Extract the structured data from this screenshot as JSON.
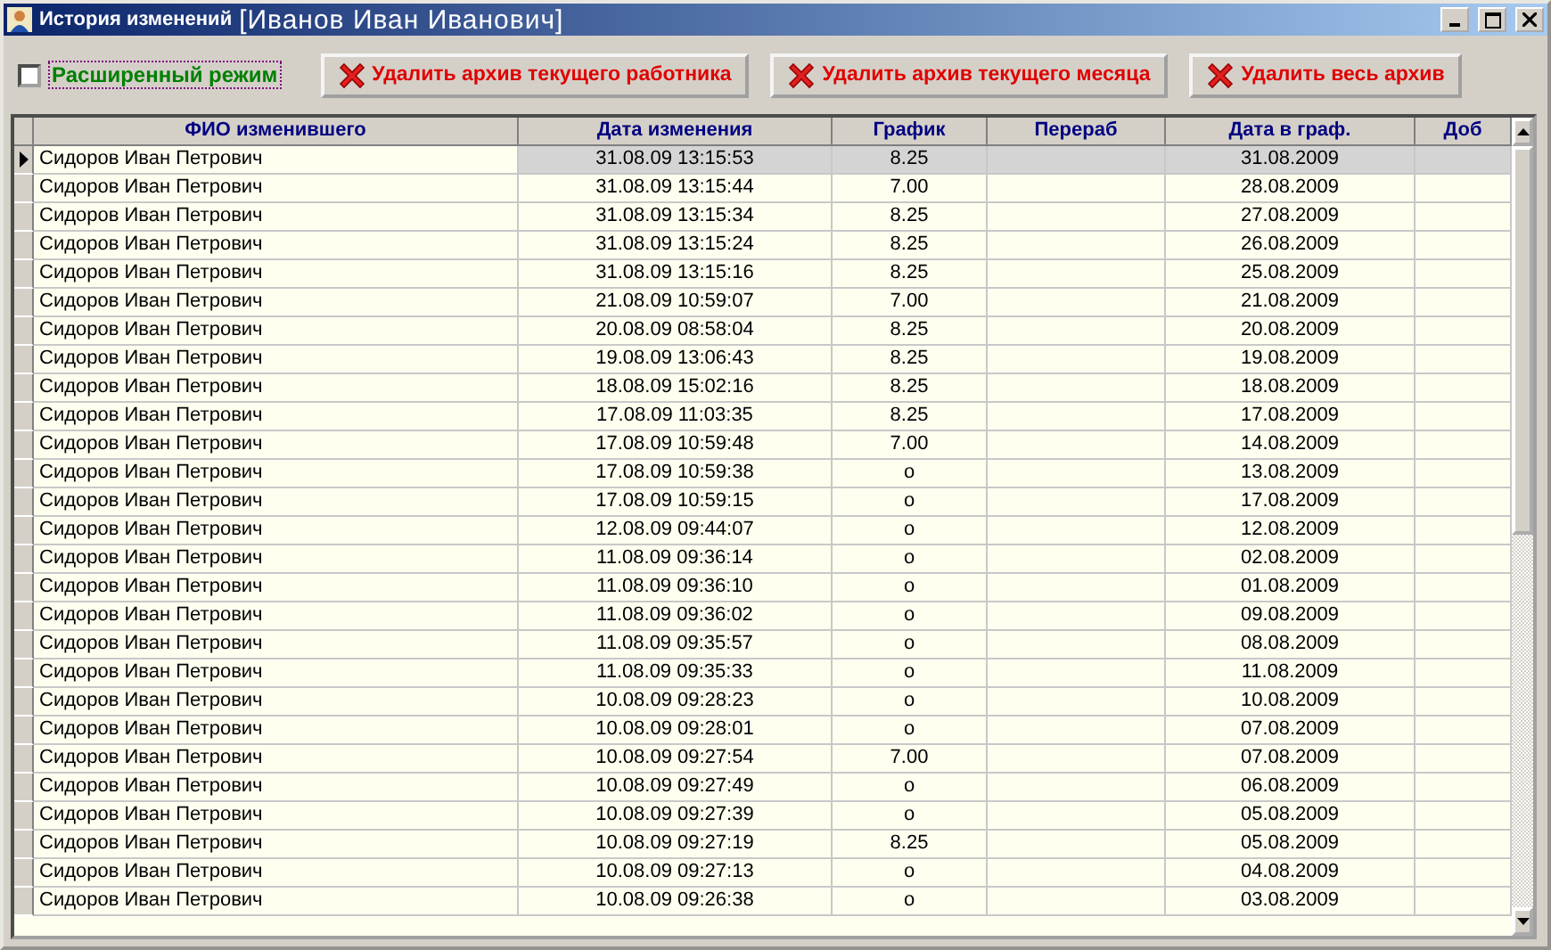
{
  "window": {
    "title": "История изменений",
    "subtitle": "[Иванов Иван Иванович]"
  },
  "extended_mode": {
    "label": "Расширенный режим",
    "checked": false
  },
  "buttons": [
    "Удалить архив текущего работника",
    "Удалить архив текущего месяца",
    "Удалить весь архив"
  ],
  "table": {
    "columns": [
      "ФИО изменившего",
      "Дата изменения",
      "График",
      "Перераб",
      "Дата в граф.",
      "Доб"
    ],
    "rows": [
      {
        "name": "Сидоров Иван Петрович",
        "changed": "31.08.09 13:15:53",
        "schedule": "8.25",
        "date": "31.08.2009",
        "selected": true
      },
      {
        "name": "Сидоров Иван Петрович",
        "changed": "31.08.09 13:15:44",
        "schedule": "7.00",
        "date": "28.08.2009",
        "selected": false
      },
      {
        "name": "Сидоров Иван Петрович",
        "changed": "31.08.09 13:15:34",
        "schedule": "8.25",
        "date": "27.08.2009",
        "selected": false
      },
      {
        "name": "Сидоров Иван Петрович",
        "changed": "31.08.09 13:15:24",
        "schedule": "8.25",
        "date": "26.08.2009",
        "selected": false
      },
      {
        "name": "Сидоров Иван Петрович",
        "changed": "31.08.09 13:15:16",
        "schedule": "8.25",
        "date": "25.08.2009",
        "selected": false
      },
      {
        "name": "Сидоров Иван Петрович",
        "changed": "21.08.09 10:59:07",
        "schedule": "7.00",
        "date": "21.08.2009",
        "selected": false
      },
      {
        "name": "Сидоров Иван Петрович",
        "changed": "20.08.09 08:58:04",
        "schedule": "8.25",
        "date": "20.08.2009",
        "selected": false
      },
      {
        "name": "Сидоров Иван Петрович",
        "changed": "19.08.09 13:06:43",
        "schedule": "8.25",
        "date": "19.08.2009",
        "selected": false
      },
      {
        "name": "Сидоров Иван Петрович",
        "changed": "18.08.09 15:02:16",
        "schedule": "8.25",
        "date": "18.08.2009",
        "selected": false
      },
      {
        "name": "Сидоров Иван Петрович",
        "changed": "17.08.09 11:03:35",
        "schedule": "8.25",
        "date": "17.08.2009",
        "selected": false
      },
      {
        "name": "Сидоров Иван Петрович",
        "changed": "17.08.09 10:59:48",
        "schedule": "7.00",
        "date": "14.08.2009",
        "selected": false
      },
      {
        "name": "Сидоров Иван Петрович",
        "changed": "17.08.09 10:59:38",
        "schedule": "o",
        "date": "13.08.2009",
        "selected": false
      },
      {
        "name": "Сидоров Иван Петрович",
        "changed": "17.08.09 10:59:15",
        "schedule": "o",
        "date": "17.08.2009",
        "selected": false
      },
      {
        "name": "Сидоров Иван Петрович",
        "changed": "12.08.09 09:44:07",
        "schedule": "o",
        "date": "12.08.2009",
        "selected": false
      },
      {
        "name": "Сидоров Иван Петрович",
        "changed": "11.08.09 09:36:14",
        "schedule": "o",
        "date": "02.08.2009",
        "selected": false
      },
      {
        "name": "Сидоров Иван Петрович",
        "changed": "11.08.09 09:36:10",
        "schedule": "o",
        "date": "01.08.2009",
        "selected": false
      },
      {
        "name": "Сидоров Иван Петрович",
        "changed": "11.08.09 09:36:02",
        "schedule": "o",
        "date": "09.08.2009",
        "selected": false
      },
      {
        "name": "Сидоров Иван Петрович",
        "changed": "11.08.09 09:35:57",
        "schedule": "o",
        "date": "08.08.2009",
        "selected": false
      },
      {
        "name": "Сидоров Иван Петрович",
        "changed": "11.08.09 09:35:33",
        "schedule": "o",
        "date": "11.08.2009",
        "selected": false
      },
      {
        "name": "Сидоров Иван Петрович",
        "changed": "10.08.09 09:28:23",
        "schedule": "o",
        "date": "10.08.2009",
        "selected": false
      },
      {
        "name": "Сидоров Иван Петрович",
        "changed": "10.08.09 09:28:01",
        "schedule": "o",
        "date": "07.08.2009",
        "selected": false
      },
      {
        "name": "Сидоров Иван Петрович",
        "changed": "10.08.09 09:27:54",
        "schedule": "7.00",
        "date": "07.08.2009",
        "selected": false
      },
      {
        "name": "Сидоров Иван Петрович",
        "changed": "10.08.09 09:27:49",
        "schedule": "o",
        "date": "06.08.2009",
        "selected": false
      },
      {
        "name": "Сидоров Иван Петрович",
        "changed": "10.08.09 09:27:39",
        "schedule": "o",
        "date": "05.08.2009",
        "selected": false
      },
      {
        "name": "Сидоров Иван Петрович",
        "changed": "10.08.09 09:27:19",
        "schedule": "8.25",
        "date": "05.08.2009",
        "selected": false
      },
      {
        "name": "Сидоров Иван Петрович",
        "changed": "10.08.09 09:27:13",
        "schedule": "o",
        "date": "04.08.2009",
        "selected": false
      },
      {
        "name": "Сидоров Иван Петрович",
        "changed": "10.08.09 09:26:38",
        "schedule": "o",
        "date": "03.08.2009",
        "selected": false
      }
    ]
  }
}
